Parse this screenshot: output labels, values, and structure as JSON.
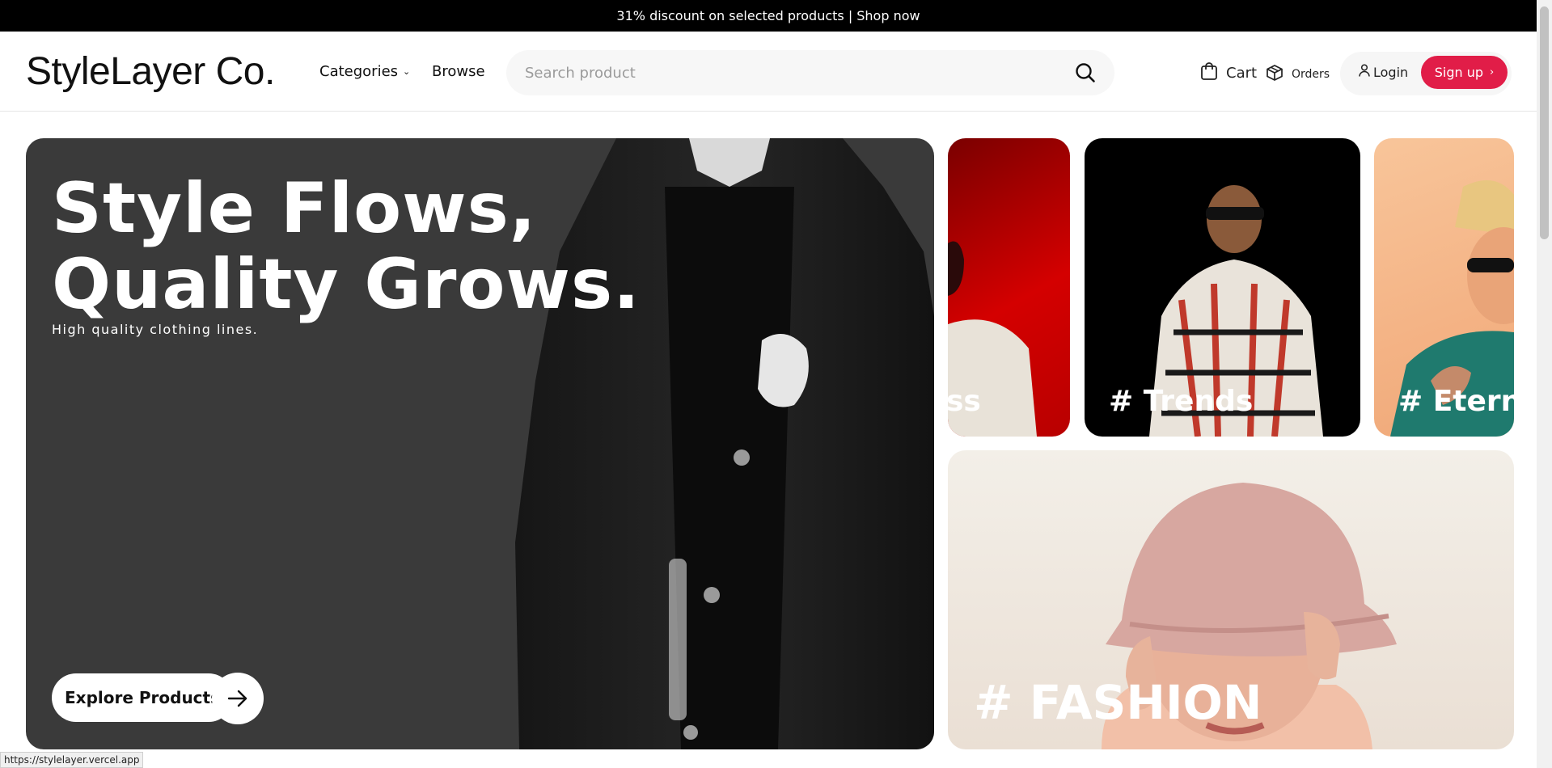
{
  "promo": {
    "text": "31% discount on selected products |",
    "link": "Shop now"
  },
  "header": {
    "logo": "StyleLayer Co.",
    "nav": {
      "categories": "Categories",
      "browse": "Browse"
    },
    "search": {
      "placeholder": "Search product",
      "value": ""
    },
    "cart": "Cart",
    "orders": "Orders",
    "login": "Login",
    "signup": "Sign up"
  },
  "hero": {
    "title_line1": "Style Flows,",
    "title_line2": "Quality Grows.",
    "subtitle": "High quality clothing lines.",
    "cta": "Explore Products"
  },
  "cards": {
    "business": "ss",
    "trends": "# Trends",
    "eternal": "# Eterna",
    "fashion": "# FASHION"
  },
  "status_url": "https://stylelayer.vercel.app",
  "colors": {
    "accent": "#e11d48",
    "promo_bg": "#000000",
    "hero_bg": "#3a3a3a"
  }
}
